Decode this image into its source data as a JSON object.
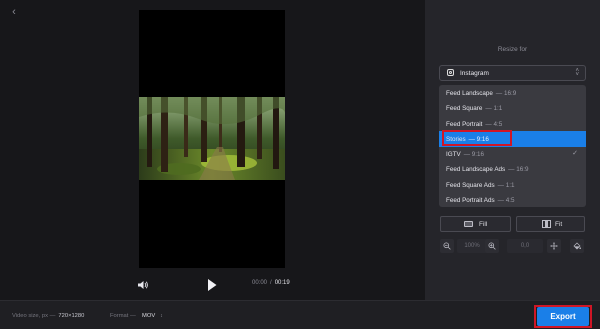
{
  "icons": {
    "back": "back-arrow-icon",
    "volume": "volume-icon",
    "play": "play-icon",
    "instagram": "instagram-icon",
    "chevron": "chevron-updown-icon",
    "check": "check-icon",
    "fill": "fill-icon",
    "fit": "fit-icon",
    "zoom_out": "zoom-out-icon",
    "zoom_in": "zoom-in-icon",
    "move": "move-icon",
    "bucket": "paint-bucket-icon"
  },
  "player": {
    "current_time": "00:00",
    "separator": "/",
    "total_time": "00:19"
  },
  "panel": {
    "title": "Resize for",
    "platform": "Instagram",
    "options": [
      {
        "name": "Feed Landscape",
        "ratio": "— 16:9",
        "selected": false,
        "checked": false
      },
      {
        "name": "Feed Square",
        "ratio": "— 1:1",
        "selected": false,
        "checked": false
      },
      {
        "name": "Feed Portrait",
        "ratio": "— 4:5",
        "selected": false,
        "checked": false
      },
      {
        "name": "Stories",
        "ratio": "— 9:16",
        "selected": true,
        "checked": false
      },
      {
        "name": "IGTV",
        "ratio": "— 9:16",
        "selected": false,
        "checked": true
      },
      {
        "name": "Feed Landscape Ads",
        "ratio": "— 16:9",
        "selected": false,
        "checked": false
      },
      {
        "name": "Feed Square Ads",
        "ratio": "— 1:1",
        "selected": false,
        "checked": false
      },
      {
        "name": "Feed Portrait Ads",
        "ratio": "— 4:5",
        "selected": false,
        "checked": false
      }
    ],
    "fill_label": "Fill",
    "fit_label": "Fit",
    "zoom_value": "100%",
    "offset_value": "0,0"
  },
  "footer": {
    "video_size_label": "Video size, px —",
    "video_size_value": "720×1280",
    "format_label": "Format —",
    "format_value": "MOV",
    "export_label": "Export"
  },
  "colors": {
    "accent": "#1a7fe8",
    "highlight": "#d01626",
    "background": "#1b1b1f"
  }
}
